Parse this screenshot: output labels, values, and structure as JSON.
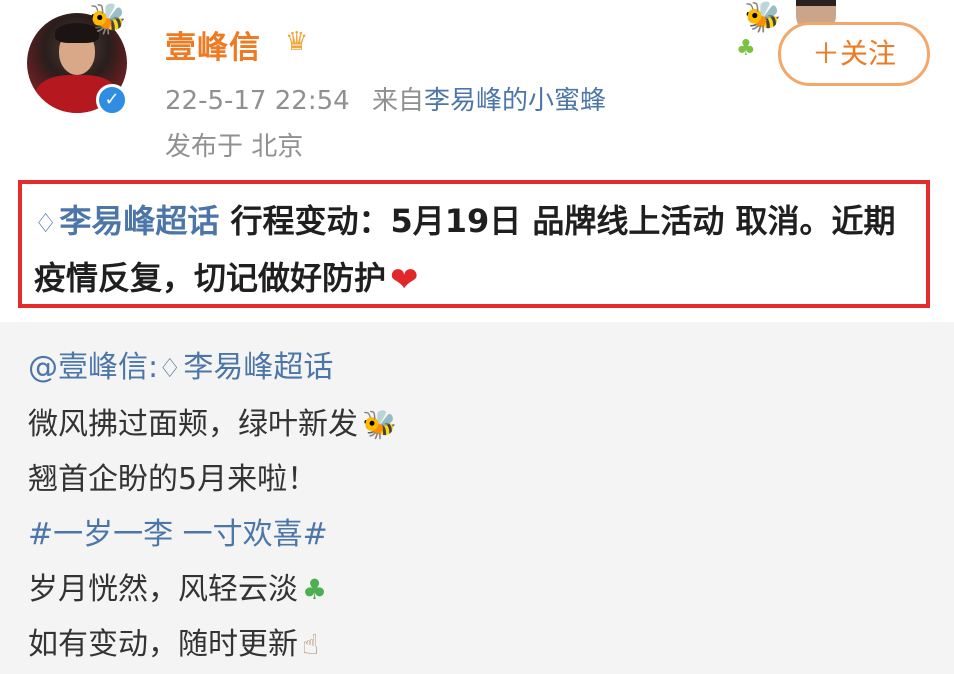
{
  "header": {
    "username": "壹峰信",
    "timestamp": "22-5-17 22:54",
    "source_prefix": "来自",
    "source": "李易峰的小蜜蜂",
    "location": "发布于 北京",
    "follow_label": "＋关注"
  },
  "post": {
    "topic": "李易峰超话",
    "text": " 行程变动：5月19日 品牌线上活动 取消。近期疫情反复，切记做好防护"
  },
  "repost": {
    "mention": "@壹峰信",
    "mention_sep": ":",
    "topic": "李易峰超话",
    "line1": "微风拂过面颊，绿叶新发",
    "line2": "翘首企盼的5月来啦！",
    "hashtag": "#一岁一李 一寸欢喜#",
    "line3": "岁月恍然，风轻云淡",
    "line4": "如有变动，随时更新"
  },
  "icons": {
    "verified": "verified-icon",
    "crown": "crown-icon",
    "diamond": "diamond-icon",
    "heart": "heart-icon",
    "bee": "bee-icon",
    "clover": "clover-icon",
    "hand": "finger-heart-icon"
  },
  "colors": {
    "username": "#ee7a22",
    "link": "#4d76a8",
    "highlight_border": "#e52b2b",
    "repost_bg": "#f4f4f4"
  }
}
